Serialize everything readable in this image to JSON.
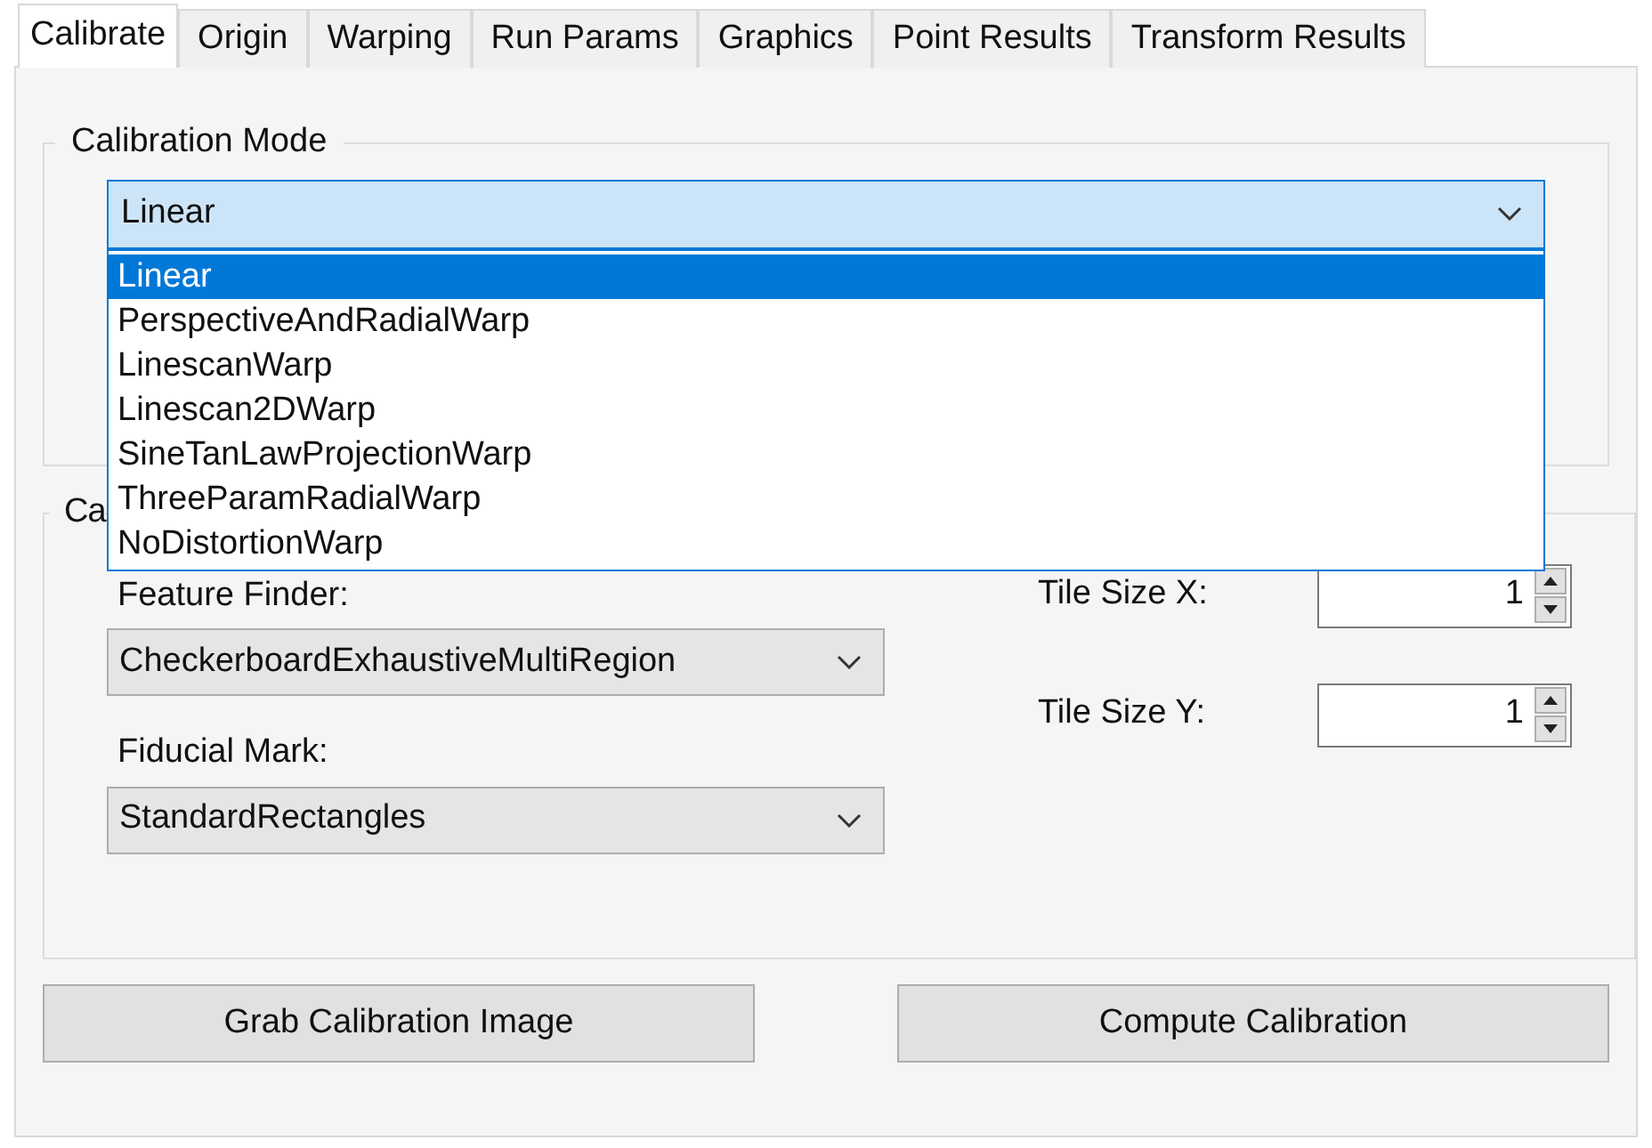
{
  "tabs": [
    {
      "label": "Calibrate",
      "selected": true
    },
    {
      "label": "Origin",
      "selected": false
    },
    {
      "label": "Warping",
      "selected": false
    },
    {
      "label": "Run Params",
      "selected": false
    },
    {
      "label": "Graphics",
      "selected": false
    },
    {
      "label": "Point Results",
      "selected": false
    },
    {
      "label": "Transform Results",
      "selected": false
    }
  ],
  "calibration_mode": {
    "legend": "Calibration Mode",
    "value": "Linear",
    "expanded": true,
    "options": [
      {
        "label": "Linear",
        "selected": true
      },
      {
        "label": "PerspectiveAndRadialWarp",
        "selected": false
      },
      {
        "label": "LinescanWarp",
        "selected": false
      },
      {
        "label": "Linescan2DWarp",
        "selected": false
      },
      {
        "label": "SineTanLawProjectionWarp",
        "selected": false
      },
      {
        "label": "ThreeParamRadialWarp",
        "selected": false
      },
      {
        "label": "NoDistortionWarp",
        "selected": false
      }
    ]
  },
  "calibration_group": {
    "legend": "Ca",
    "feature_finder": {
      "label": "Feature Finder:",
      "value": "CheckerboardExhaustiveMultiRegion"
    },
    "fiducial_mark": {
      "label": "Fiducial Mark:",
      "value": "StandardRectangles"
    },
    "tile_size_x": {
      "label": "Tile Size X:",
      "value": "1"
    },
    "tile_size_y": {
      "label": "Tile Size Y:",
      "value": "1"
    }
  },
  "buttons": [
    "Grab Calibration Image",
    "Compute Calibration"
  ]
}
